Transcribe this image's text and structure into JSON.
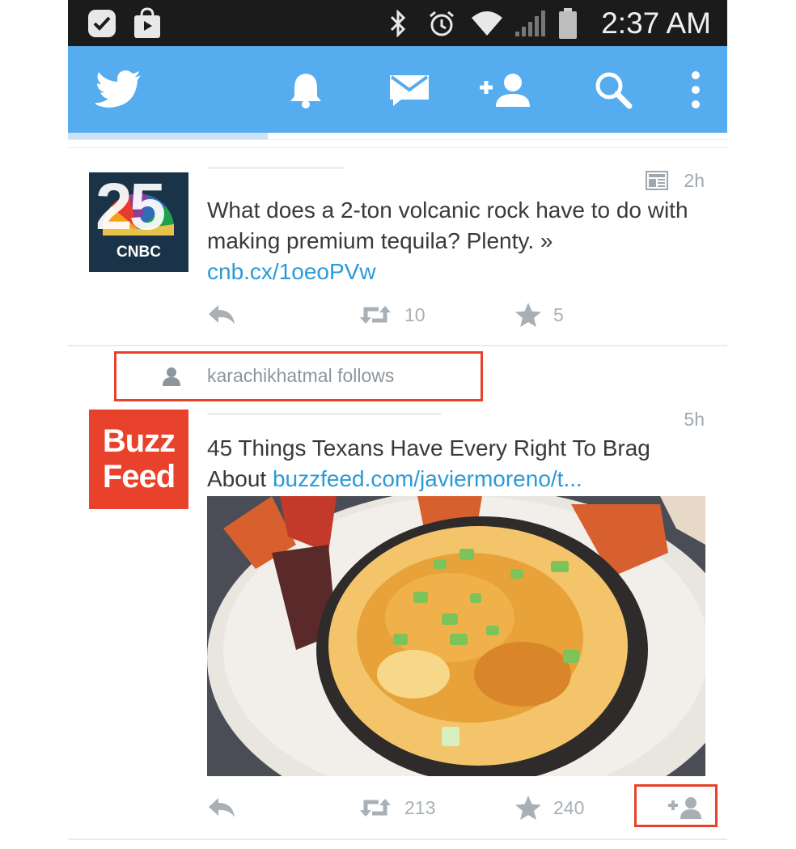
{
  "status_bar": {
    "time": "2:37 AM",
    "left_icons": [
      "check-badge-icon",
      "play-store-icon"
    ],
    "right_icons": [
      "bluetooth-icon",
      "alarm-icon",
      "wifi-icon",
      "signal-icon",
      "battery-icon"
    ]
  },
  "action_bar": {
    "icons": [
      "twitter-bird-icon",
      "notifications-bell-icon",
      "messages-envelope-icon",
      "add-user-icon",
      "search-icon",
      "overflow-menu-icon"
    ],
    "brand_color": "#55acee"
  },
  "timeline": {
    "tweets": [
      {
        "avatar_text_top": "25",
        "avatar_text_bottom": "CNBC",
        "card_icon": "summary-card-icon",
        "time": "2h",
        "text": "What does a 2-ton volcanic rock have to do with making premium tequila? Plenty. »",
        "link": "cnb.cx/1oeoPVw",
        "retweets": "10",
        "favorites": "5"
      },
      {
        "social_context": "karachikhatmal follows",
        "avatar_text_top": "Buzz",
        "avatar_text_bottom": "Feed",
        "time": "5h",
        "text": "45 Things Texans Have Every Right To Brag About ",
        "link": "buzzfeed.com/javiermoreno/t...",
        "image": "queso-dip-photo",
        "retweets": "213",
        "favorites": "240",
        "follow_icon": "follow-user-icon"
      }
    ]
  },
  "colors": {
    "highlight": "#e8412c",
    "link": "#2b9ad8",
    "cnbc_bg": "#1a3348",
    "buzzfeed_bg": "#e8412c"
  }
}
